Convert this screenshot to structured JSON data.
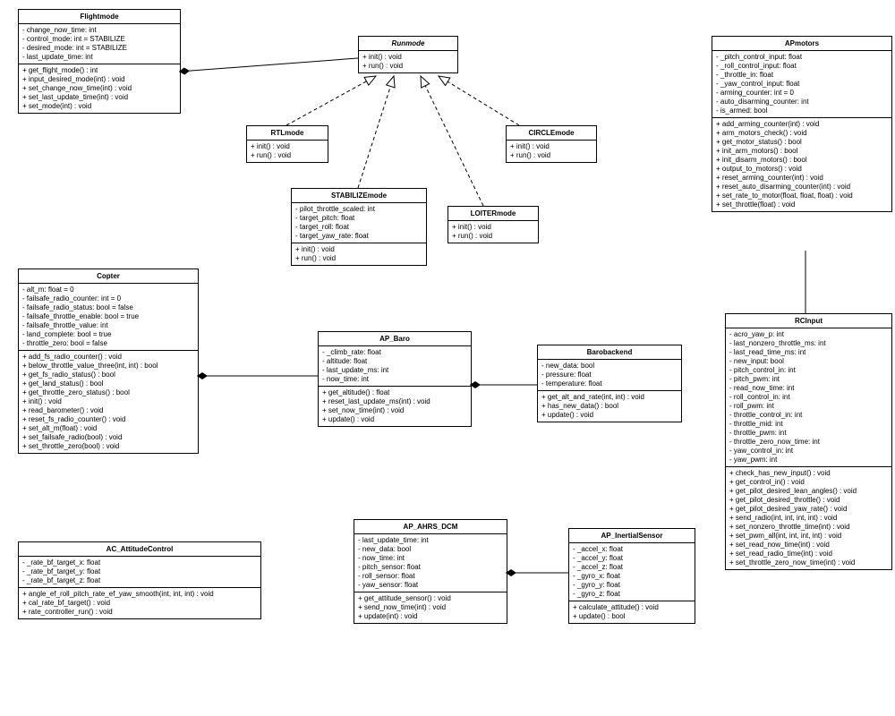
{
  "classes": {
    "Flightmode": {
      "name": "Flightmode",
      "attrs": [
        "- change_now_time: int",
        "- control_mode: int = STABILIZE",
        "- desired_mode: int = STABILIZE",
        "- last_update_time: int"
      ],
      "methods": [
        "+ get_flight_mode() : int",
        "+ input_desired_mode(int) : void",
        "+ set_change_now_time(int) : void",
        "+ set_last_update_time(int) : void",
        "+ set_mode(int) : void"
      ]
    },
    "Runmode": {
      "name": "Runmode",
      "methods": [
        "+ init() : void",
        "+ run() : void"
      ]
    },
    "RTLmode": {
      "name": "RTLmode",
      "methods": [
        "+ init() : void",
        "+ run() : void"
      ]
    },
    "CIRCLEmode": {
      "name": "CIRCLEmode",
      "methods": [
        "+ init() : void",
        "+ run() : void"
      ]
    },
    "STABILIZEmode": {
      "name": "STABILIZEmode",
      "attrs": [
        "- pilot_throttle_scaled: int",
        "- target_pitch: float",
        "- target_roll: float",
        "- target_yaw_rate: float"
      ],
      "methods": [
        "+ init() : void",
        "+ run() : void"
      ]
    },
    "LOITERmode": {
      "name": "LOITERmode",
      "methods": [
        "+ init() : void",
        "+ run() : void"
      ]
    },
    "APmotors": {
      "name": "APmotors",
      "attrs": [
        "- _pitch_control_input: float",
        "- _roll_control_input: float",
        "- _throttle_in: float",
        "- _yaw_control_input: float",
        "- arming_counter: int = 0",
        "- auto_disarming_counter: int",
        "- is_armed: bool"
      ],
      "methods": [
        "+ add_arming_counter(int) : void",
        "+ arm_motors_check() : void",
        "+ get_motor_status() : bool",
        "+ init_arm_motors() : bool",
        "+ init_disarm_motors() : bool",
        "+ output_to_motors() : void",
        "+ reset_arming_counter(int) : void",
        "+ reset_auto_disarming_counter(int) : void",
        "+ set_rate_to_motor(float, float, float) : void",
        "+ set_throttle(float) : void"
      ]
    },
    "Copter": {
      "name": "Copter",
      "attrs": [
        "- alt_m: float = 0",
        "- failsafe_radio_counter: int = 0",
        "- failsafe_radio_status: bool = false",
        "- failsafe_throttle_enable: bool = true",
        "- failsafe_throttle_value: int",
        "- land_complete: bool = true",
        "- throttle_zero: bool = false"
      ],
      "methods": [
        "+ add_fs_radio_counter() : void",
        "+ below_throttle_value_three(int, int) : bool",
        "+ get_fs_radio_status() : bool",
        "+ get_land_status() : bool",
        "+ get_throttle_zero_status() : bool",
        "+ init() : void",
        "+ read_barometer() : void",
        "+ reset_fs_radio_counter() : void",
        "+ set_alt_m(float) : void",
        "+ set_failsafe_radio(bool) : void",
        "+ set_throttle_zero(bool) : void"
      ]
    },
    "AP_Baro": {
      "name": "AP_Baro",
      "attrs": [
        "- _climb_rate: float",
        "- altitude: float",
        "- last_update_ms: int",
        "- now_time: int"
      ],
      "methods": [
        "+ get_altitude() : float",
        "+ reset_last_update_ms(int) : void",
        "+ set_now_time(int) : void",
        "+ update() : void"
      ]
    },
    "Barobackend": {
      "name": "Barobackend",
      "attrs": [
        "- new_data: bool",
        "- pressure: float",
        "- temperature: float"
      ],
      "methods": [
        "+ get_alt_and_rate(int, int) : void",
        "+ has_new_data() : bool",
        "+ update() : void"
      ]
    },
    "RCInput": {
      "name": "RCInput",
      "attrs": [
        "- acro_yaw_p: int",
        "- last_nonzero_throttle_ms: int",
        "- last_read_time_ms: int",
        "- new_input: bool",
        "- pitch_control_in: int",
        "- pitch_pwm: int",
        "- read_now_time: int",
        "- roll_control_in: int",
        "- roll_pwm: int",
        "- throttle_control_in: int",
        "- throttle_mid: int",
        "- throttle_pwm: int",
        "- throttle_zero_now_time: int",
        "- yaw_control_in: int",
        "- yaw_pwm: int"
      ],
      "methods": [
        "+ check_has_new_input() : void",
        "+ get_control_in() : void",
        "+ get_pilot_desired_lean_angles() : void",
        "+ get_pilot_desired_throttle() : void",
        "+ get_pilot_desired_yaw_rate() : void",
        "+ send_radio(int, int, int, int) : void",
        "+ set_nonzero_throttle_time(int) : void",
        "+ set_pwm_all(int, int, int, int) : void",
        "+ set_read_now_time(int) : void",
        "+ set_read_radio_time(int) : void",
        "+ set_throttle_zero_now_time(int) : void"
      ]
    },
    "AC_AttitudeControl": {
      "name": "AC_AttitudeControl",
      "attrs": [
        "- _rate_bf_target_x: float",
        "- _rate_bf_target_y: float",
        "- _rate_bf_target_z: float"
      ],
      "methods": [
        "+ angle_ef_roll_pitch_rate_ef_yaw_smooth(int, int, int) : void",
        "+ cal_rate_bf_target() : void",
        "+ rate_controller_run() : void"
      ]
    },
    "AP_AHRS_DCM": {
      "name": "AP_AHRS_DCM",
      "attrs": [
        "- last_update_time: int",
        "- new_data: bool",
        "- now_time: int",
        "- pitch_sensor: float",
        "- roll_sensor: float",
        "- yaw_sensor: float"
      ],
      "methods": [
        "+ get_attitude_sensor() : void",
        "+ send_now_time(int) : void",
        "+ update(int) : void"
      ]
    },
    "AP_InertialSensor": {
      "name": "AP_InertialSensor",
      "attrs": [
        "- _accel_x: float",
        "- _accel_y: float",
        "- _accel_z: float",
        "- _gyro_x: float",
        "- _gyro_y: float",
        "- _gyro_z: float"
      ],
      "methods": [
        "+ calculate_attitude() : void",
        "+ update() : bool"
      ]
    }
  },
  "relations": [
    {
      "from": "Runmode",
      "to": "Flightmode",
      "type": "composition"
    },
    {
      "from": "RTLmode",
      "to": "Runmode",
      "type": "inherit"
    },
    {
      "from": "STABILIZEmode",
      "to": "Runmode",
      "type": "inherit"
    },
    {
      "from": "LOITERmode",
      "to": "Runmode",
      "type": "inherit"
    },
    {
      "from": "CIRCLEmode",
      "to": "Runmode",
      "type": "inherit"
    },
    {
      "from": "AP_Baro",
      "to": "Copter",
      "type": "composition"
    },
    {
      "from": "Barobackend",
      "to": "AP_Baro",
      "type": "composition"
    },
    {
      "from": "AP_InertialSensor",
      "to": "AP_AHRS_DCM",
      "type": "composition"
    },
    {
      "from": "APmotors",
      "to": "RCInput",
      "type": "assoc"
    }
  ]
}
